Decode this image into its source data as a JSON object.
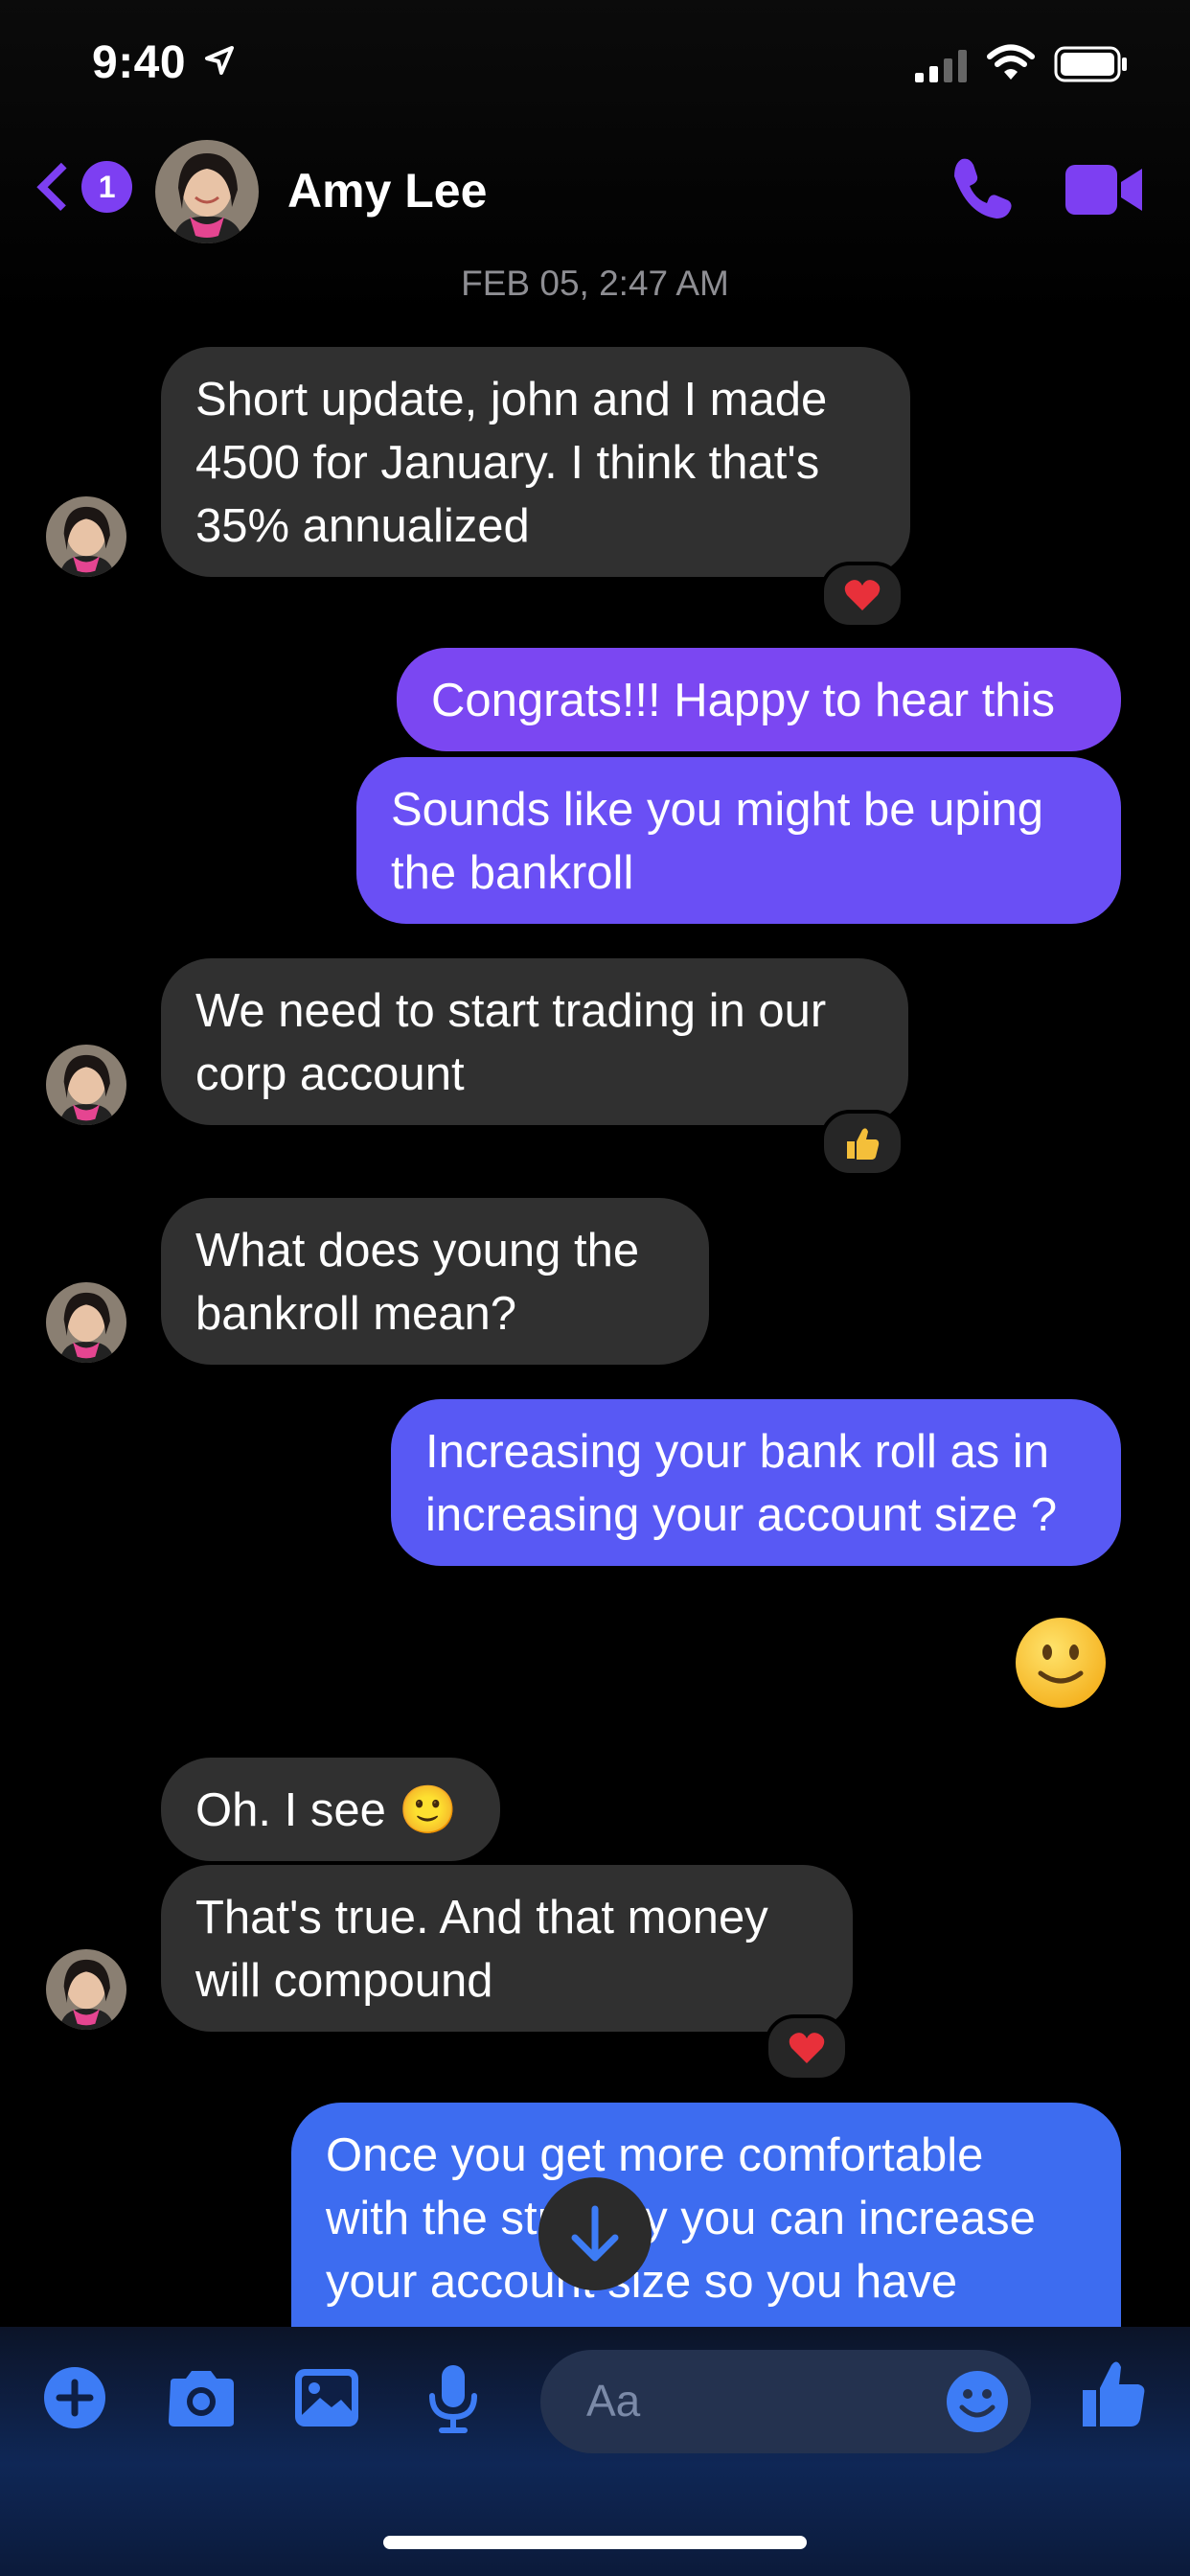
{
  "status_bar": {
    "time": "9:40"
  },
  "header": {
    "back_badge_count": "1",
    "contact_name": "Amy Lee"
  },
  "thread": {
    "timestamp": "FEB 05, 2:47 AM",
    "messages": [
      {
        "sender": "Amy Lee",
        "text_lines": [
          "Short update, john and I made",
          "4500 for January. I think that's",
          "35% annualized"
        ],
        "reaction": "heart"
      },
      {
        "sender": "me",
        "text_lines": [
          "Congrats!!! Happy to hear this"
        ]
      },
      {
        "sender": "me",
        "text_lines": [
          "Sounds like you might be uping",
          "the bankroll"
        ]
      },
      {
        "sender": "Amy Lee",
        "text_lines": [
          "We need to start trading in our",
          "corp account"
        ],
        "reaction": "thumbs-up"
      },
      {
        "sender": "Amy Lee",
        "text_lines": [
          "What does young the",
          "bankroll mean?"
        ]
      },
      {
        "sender": "me",
        "text_lines": [
          "Increasing your bank roll as in",
          "increasing your account size ?"
        ]
      },
      {
        "sender": "me",
        "emoji": "slightly-smiling-face"
      },
      {
        "sender": "Amy Lee",
        "text_lines": [
          "Oh. I see 🙂"
        ]
      },
      {
        "sender": "Amy Lee",
        "text_lines": [
          "That's true. And that money",
          "will compound"
        ],
        "reaction": "heart"
      },
      {
        "sender": "me",
        "text_lines": [
          "Once you get more comfortable",
          "with the strategy you can increase",
          "your account size so you have"
        ]
      }
    ]
  },
  "composer": {
    "placeholder": "Aa"
  },
  "colors": {
    "accent_purple": "#7d3ff2",
    "accent_blue": "#3d6cf0",
    "incoming_bubble": "#303030"
  }
}
